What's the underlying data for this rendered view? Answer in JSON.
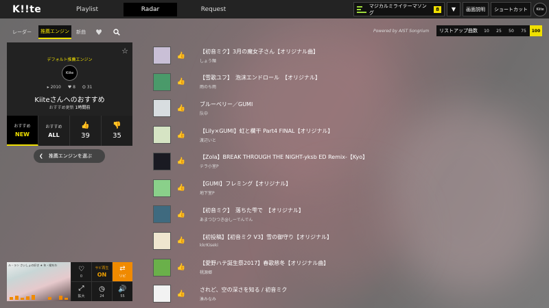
{
  "app": {
    "logo": "K!!te"
  },
  "nav": {
    "tabs": [
      "Playlist",
      "Radar",
      "Request"
    ],
    "active": "Radar"
  },
  "topright": {
    "theme_label": "マジカルミライテーマソング",
    "theme_count": "8",
    "help": "画面説明",
    "shortcut": "ショートカット",
    "avatar_text": "Kiite"
  },
  "left": {
    "tabs": [
      "レーダー",
      "推薦エンジン",
      "新曲"
    ],
    "active_tab": "推薦エンジン",
    "card": {
      "subtitle": "デフォルト推薦エンジン",
      "avatar_text": "Kiite",
      "stats": [
        "2010",
        "8",
        "31"
      ],
      "title": "Kiiteさんへのおすすめ",
      "updated_label": "おすすめ更新",
      "updated_value": "1時間前"
    },
    "buttons": [
      {
        "top": "おすすめ",
        "value": "NEW"
      },
      {
        "top": "おすすめ",
        "value": "ALL"
      },
      {
        "top": "",
        "value": "39"
      },
      {
        "top": "",
        "value": "35"
      }
    ],
    "choose_label": "推薦エンジンを選ぶ"
  },
  "player": {
    "heart_count": "0",
    "sabi_label": "サビ再生",
    "sabi_value": "ON",
    "orange_label": "リピ",
    "expand_label": "拡大",
    "timer_label": "24",
    "volume_label": "55",
    "thumb_text": "ル・ラン   さいしょの好き   ★ 年・縦をわ"
  },
  "right": {
    "powered_by": "Powered by AIST Songrium",
    "list_count_label": "リストアップ曲数",
    "list_count_options": [
      "10",
      "25",
      "50",
      "75",
      "100"
    ],
    "list_count_selected": "100"
  },
  "songs": [
    {
      "title": "【初音ミク】3月の魔女子さん【オリジナル曲】",
      "artist": "しょう麺",
      "thumb_color": "#c9bfd6"
    },
    {
      "title": "【雪歌ユフ】　泡沫エンドロール　【オリジナル】",
      "artist": "雨のち雨",
      "thumb_color": "#4a9a6a"
    },
    {
      "title": "ブルーベリー／GUMI",
      "artist": "队中",
      "thumb_color": "#d8dde0"
    },
    {
      "title": "【Lily×GUMI】虹と欄干 Part4 FINAL【オリジナル】",
      "artist": "渡辺いと",
      "thumb_color": "#d6e4c4"
    },
    {
      "title": "【Zola】BREAK THROUGH THE NIGHT-yksb ED Remix-【Kyo】",
      "artist": "テラ小室P",
      "thumb_color": "#1a1a22"
    },
    {
      "title": "【GUMI】フレミング【オリジナル】",
      "artist": "地下室P",
      "thumb_color": "#8ad08a"
    },
    {
      "title": "【初音ミク】　落ちた雫で　【オリジナル】",
      "artist": "あまつひつき@しーでんでん",
      "thumb_color": "#3f6a7f"
    },
    {
      "title": "【初投稿】【初音ミク V3】雪の御守り【オリジナル】",
      "artist": "kkrKiseki",
      "thumb_color": "#efe6cf"
    },
    {
      "title": "【愛野ハテ誕生祭2017】春歌慈冬【オリジナル曲】",
      "artist": "桃源郷",
      "thumb_color": "#6ab04a"
    },
    {
      "title": "されど、空の深さを知る / 初音ミク",
      "artist": "湊みなみ",
      "thumb_color": "#f2f2f2"
    }
  ]
}
